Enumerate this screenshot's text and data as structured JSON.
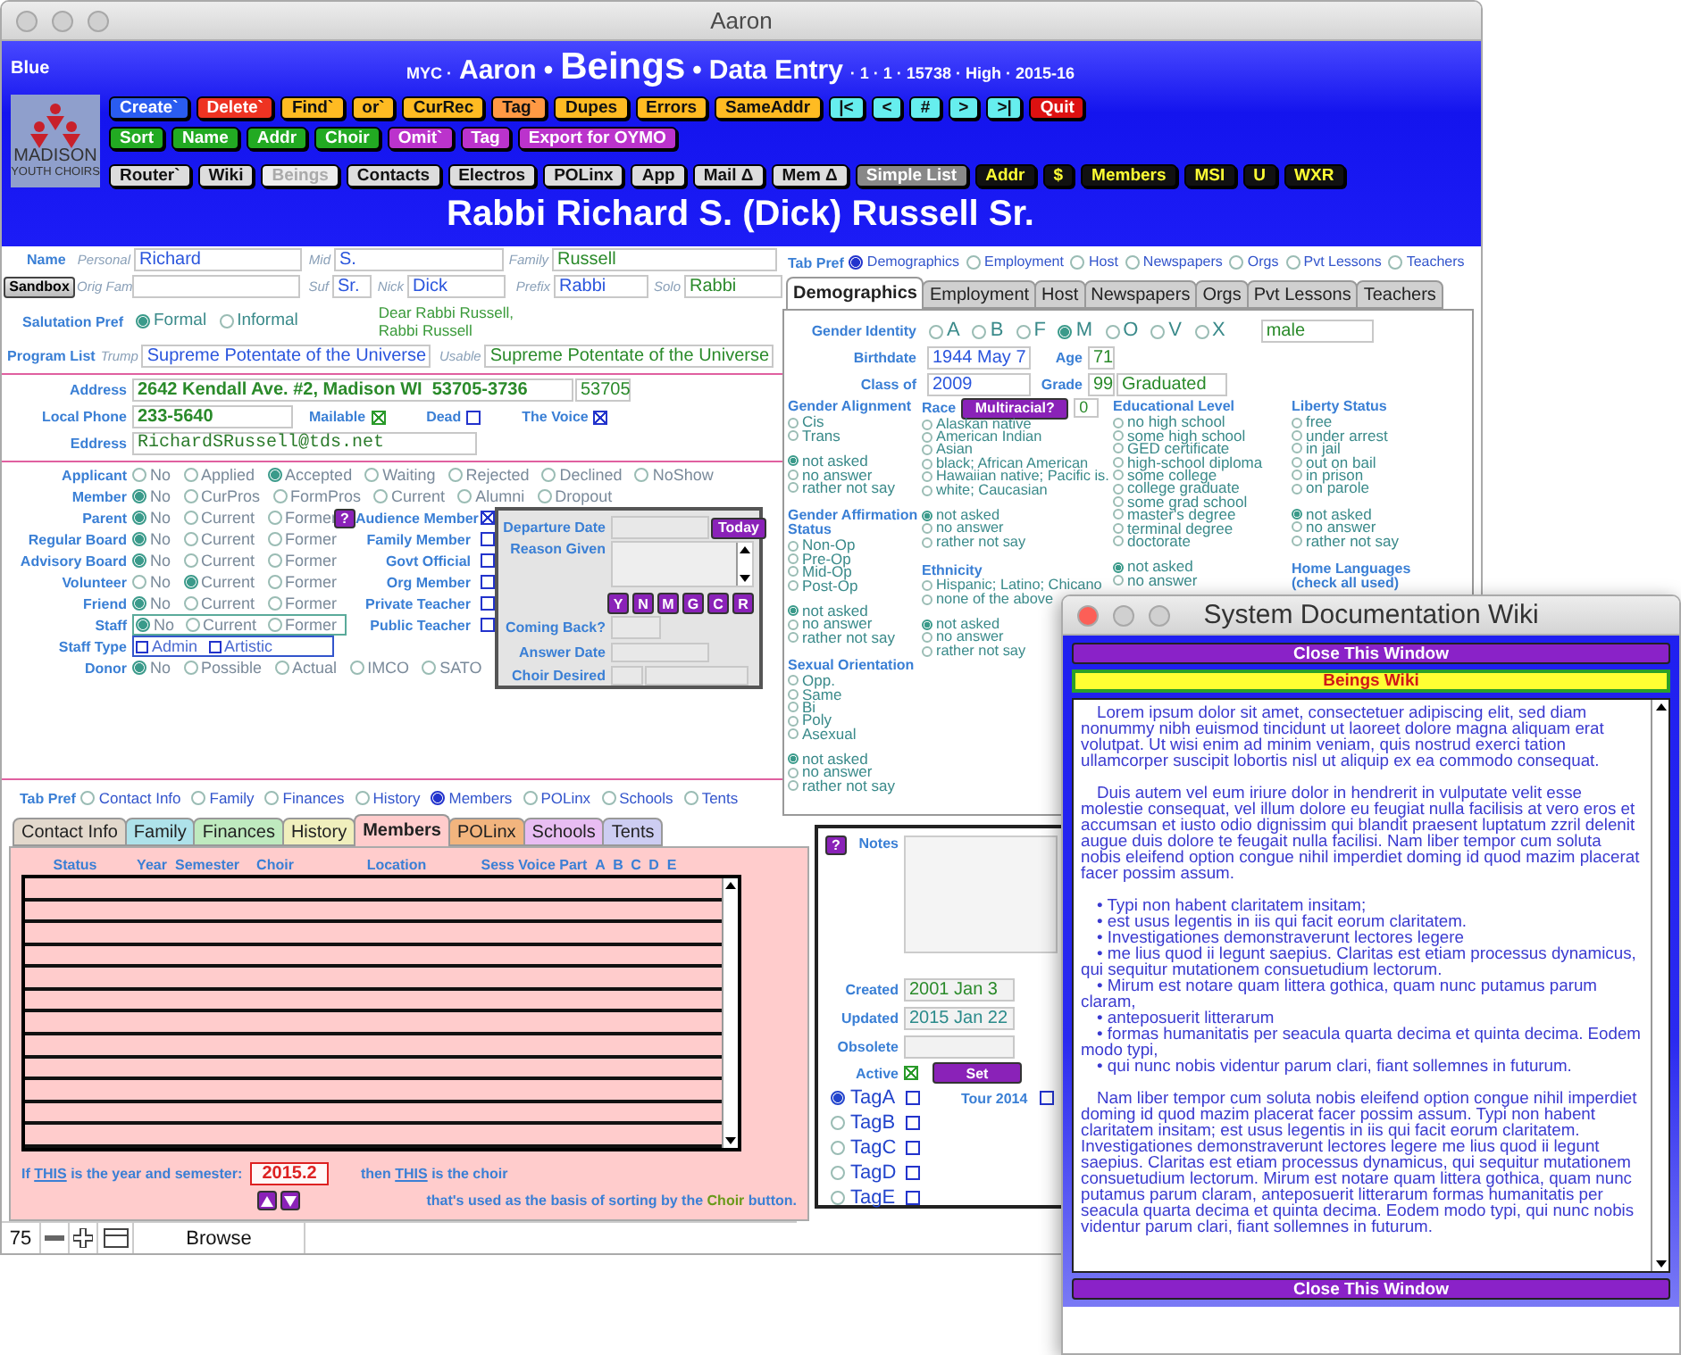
{
  "window": {
    "title": "Aaron"
  },
  "header": {
    "label": "Blue",
    "title": [
      {
        "text": "MYC ·",
        "kind": "small"
      },
      {
        "text": "Aaron",
        "kind": "medium"
      },
      {
        "text": "•",
        "kind": "medium"
      },
      {
        "text": "Beings",
        "kind": "large"
      },
      {
        "text": "•",
        "kind": "medium"
      },
      {
        "text": "Data Entry",
        "kind": "medium"
      },
      {
        "text": "· 1 · 1 · 15738 · High · 2015-16",
        "kind": "small"
      }
    ],
    "logo": [
      "MADISON",
      "YOUTH CHOIRS"
    ],
    "toolbar": [
      [
        {
          "label": "Create`",
          "color": "#2a5cf0"
        },
        {
          "label": "Delete`",
          "color": "#ee3322"
        },
        {
          "label": "Find`",
          "color": "#ffbb22"
        },
        {
          "label": "or`",
          "color": "#ffbb22"
        },
        {
          "label": "CurRec",
          "color": "#ffbb22"
        },
        {
          "label": "Tag`",
          "color": "#ff9944"
        },
        {
          "label": "Dupes",
          "color": "#ffbb22"
        },
        {
          "label": "Errors",
          "color": "#ffbb22"
        },
        {
          "label": "SameAddr",
          "color": "#ffbb22"
        },
        {
          "label": "|<",
          "color": "#66eeee"
        },
        {
          "label": "<",
          "color": "#66eeee"
        },
        {
          "label": "#",
          "color": "#66eeee"
        },
        {
          "label": ">",
          "color": "#66eeee"
        },
        {
          "label": ">|",
          "color": "#66eeee"
        },
        {
          "label": "Quit",
          "color": "#dd1111"
        }
      ],
      [
        {
          "label": "Sort",
          "color": "#22aa22"
        },
        {
          "label": "Name",
          "color": "#22aa22"
        },
        {
          "label": "Addr",
          "color": "#22aa22"
        },
        {
          "label": "Choir",
          "color": "#22aa22"
        },
        {
          "label": "Omit`",
          "color": "#bb33cc"
        },
        {
          "label": "Tag",
          "color": "#bb33cc"
        },
        {
          "label": "Export for OYMO",
          "color": "#bb33cc"
        }
      ],
      [
        {
          "label": "Router`",
          "color": "#dddddd",
          "disabled": false
        },
        {
          "label": "Wiki",
          "color": "#dddddd",
          "disabled": false
        },
        {
          "label": "Beings",
          "color": "#eeeeee",
          "disabled": true
        },
        {
          "label": "Contacts",
          "color": "#dddddd",
          "disabled": false
        },
        {
          "label": "Electros",
          "color": "#dddddd",
          "disabled": false
        },
        {
          "label": "POLinx",
          "color": "#dddddd",
          "disabled": false
        },
        {
          "label": "App",
          "color": "#dddddd",
          "disabled": false
        },
        {
          "label": "Mail Δ",
          "color": "#dddddd",
          "disabled": false
        },
        {
          "label": "Mem Δ",
          "color": "#dddddd",
          "disabled": false
        },
        {
          "label": "Simple List",
          "color": "#888888",
          "disabled": false
        },
        {
          "label": "Addr",
          "color": "#111111",
          "disabled": false
        },
        {
          "label": "$",
          "color": "#111111",
          "disabled": false
        },
        {
          "label": "Members",
          "color": "#111111",
          "disabled": false
        },
        {
          "label": "MSI",
          "color": "#111111",
          "disabled": false
        },
        {
          "label": "U",
          "color": "#111111",
          "disabled": false
        },
        {
          "label": "WXR",
          "color": "#111111",
          "disabled": false
        }
      ]
    ],
    "record_name": "Rabbi Richard S. (Dick) Russell Sr."
  },
  "identity": {
    "name_label": "Name",
    "sandbox": "Sandbox",
    "row1": [
      {
        "hint": "Personal",
        "value": "Richard",
        "kind": "entry"
      },
      {
        "hint": "Mid",
        "value": "S.",
        "kind": "entry"
      },
      {
        "hint": "Family",
        "value": "Russell",
        "kind": "calc"
      }
    ],
    "row2": [
      {
        "hint": "Orig Fam"
      },
      {
        "hint": "Suf",
        "value": "Sr.",
        "kind": "entry"
      },
      {
        "hint": "Nick",
        "value": "Dick",
        "kind": "entry"
      },
      {
        "hint": "Prefix",
        "value": "Rabbi",
        "kind": "entry"
      },
      {
        "hint": "Solo",
        "value": "Rabbi",
        "kind": "calc"
      }
    ],
    "salutation": {
      "label": "Salutation Pref",
      "options": [
        {
          "label": "Formal",
          "selected": true
        },
        {
          "label": "Informal",
          "selected": false
        }
      ],
      "greeting": [
        "Dear Rabbi Russell,",
        "Rabbi Russell"
      ]
    },
    "program": {
      "label": "Program List",
      "fields": [
        {
          "hint": "Trump",
          "value": "Supreme Potentate of the Universe",
          "kind": "entry"
        },
        {
          "hint": "Usable",
          "value": "Supreme Potentate of the Universe",
          "kind": "calc"
        }
      ]
    }
  },
  "contact": {
    "address": {
      "label": "Address",
      "value": "2642 Kendall Ave. #2, Madison WI  53705-3736",
      "zip": "53705"
    },
    "phone": {
      "label": "Local Phone",
      "value": "233-5640"
    },
    "flags": [
      {
        "label": "Mailable",
        "checked": true
      },
      {
        "label": "Dead",
        "checked": false
      },
      {
        "label": "The Voice",
        "checked": true
      }
    ],
    "eddress": {
      "label": "Eddress",
      "value": "RichardSRussell@tds.net"
    }
  },
  "status": {
    "wide": [
      {
        "label": "Applicant",
        "options": [
          {
            "label": "No",
            "selected": false
          },
          {
            "label": "Applied",
            "selected": false
          },
          {
            "label": "Accepted",
            "selected": true
          },
          {
            "label": "Waiting",
            "selected": false
          },
          {
            "label": "Rejected",
            "selected": false
          },
          {
            "label": "Declined",
            "selected": false
          },
          {
            "label": "NoShow",
            "selected": false
          }
        ]
      },
      {
        "label": "Member",
        "options": [
          {
            "label": "No",
            "selected": true
          },
          {
            "label": "CurPros",
            "selected": false
          },
          {
            "label": "FormPros",
            "selected": false
          },
          {
            "label": "Current",
            "selected": false
          },
          {
            "label": "Alumni",
            "selected": false
          },
          {
            "label": "Dropout",
            "selected": false
          }
        ]
      }
    ],
    "roles": [
      {
        "label": "Parent",
        "kind": "radio",
        "options": [
          {
            "label": "No",
            "selected": true
          },
          {
            "label": "Current",
            "selected": false
          },
          {
            "label": "Former",
            "selected": false
          }
        ]
      },
      {
        "label": "Regular Board",
        "kind": "radio",
        "options": [
          {
            "label": "No",
            "selected": true
          },
          {
            "label": "Current",
            "selected": false
          },
          {
            "label": "Former",
            "selected": false
          }
        ]
      },
      {
        "label": "Advisory Board",
        "kind": "radio",
        "options": [
          {
            "label": "No",
            "selected": true
          },
          {
            "label": "Current",
            "selected": false
          },
          {
            "label": "Former",
            "selected": false
          }
        ]
      },
      {
        "label": "Volunteer",
        "kind": "radio",
        "options": [
          {
            "label": "No",
            "selected": false
          },
          {
            "label": "Current",
            "selected": true
          },
          {
            "label": "Former",
            "selected": false
          }
        ]
      },
      {
        "label": "Friend",
        "kind": "radio",
        "options": [
          {
            "label": "No",
            "selected": true
          },
          {
            "label": "Current",
            "selected": false
          },
          {
            "label": "Former",
            "selected": false
          }
        ]
      },
      {
        "label": "Staff",
        "kind": "framed",
        "options": [
          {
            "label": "No",
            "selected": true
          },
          {
            "label": "Current",
            "selected": false
          },
          {
            "label": "Former",
            "selected": false
          }
        ]
      },
      {
        "label": "Staff Type",
        "kind": "checks",
        "options": [
          {
            "label": "Admin",
            "checked": false
          },
          {
            "label": "Artistic",
            "checked": false
          }
        ]
      },
      {
        "label": "Donor",
        "kind": "radio",
        "options": [
          {
            "label": "No",
            "selected": true
          },
          {
            "label": "Possible",
            "selected": false
          },
          {
            "label": "Actual",
            "selected": false
          },
          {
            "label": "IMCO",
            "selected": false
          },
          {
            "label": "SATO",
            "selected": false
          }
        ]
      }
    ],
    "help": "?",
    "checks": [
      {
        "label": "Audience Member",
        "checked": true
      },
      {
        "label": "Family Member",
        "checked": false
      },
      {
        "label": "Govt Official",
        "checked": false
      },
      {
        "label": "Org Member",
        "checked": false
      },
      {
        "label": "Private Teacher",
        "checked": false
      },
      {
        "label": "Public Teacher",
        "checked": false
      }
    ],
    "departure": {
      "date_label": "Departure Date",
      "today": "Today",
      "reason_label": "Reason Given",
      "coming_back_label": "Coming Back?",
      "answers": [
        "Y",
        "N",
        "M",
        "G",
        "C",
        "R"
      ],
      "answer_date_label": "Answer Date",
      "choir_label": "Choir Desired"
    }
  },
  "demographics": {
    "tab_pref": {
      "label": "Tab Pref",
      "options": [
        {
          "label": "Demographics",
          "selected": true
        },
        {
          "label": "Employment",
          "selected": false
        },
        {
          "label": "Host",
          "selected": false
        },
        {
          "label": "Newspapers",
          "selected": false
        },
        {
          "label": "Orgs",
          "selected": false
        },
        {
          "label": "Pvt Lessons",
          "selected": false
        },
        {
          "label": "Teachers",
          "selected": false
        }
      ]
    },
    "tabs": [
      {
        "label": "Demographics",
        "selected": true
      },
      {
        "label": "Employment",
        "selected": false
      },
      {
        "label": "Host",
        "selected": false
      },
      {
        "label": "Newspapers",
        "selected": false
      },
      {
        "label": "Orgs",
        "selected": false
      },
      {
        "label": "Pvt Lessons",
        "selected": false
      },
      {
        "label": "Teachers",
        "selected": false
      }
    ],
    "gender_identity": {
      "label": "Gender Identity",
      "options": [
        {
          "label": "A",
          "selected": false
        },
        {
          "label": "B",
          "selected": false
        },
        {
          "label": "F",
          "selected": false
        },
        {
          "label": "M",
          "selected": true
        },
        {
          "label": "O",
          "selected": false
        },
        {
          "label": "V",
          "selected": false
        },
        {
          "label": "X",
          "selected": false
        }
      ],
      "value": "male"
    },
    "birthdate": {
      "label": "Birthdate",
      "value": "1944 May 7"
    },
    "age": {
      "label": "Age",
      "value": "71"
    },
    "class_of": {
      "label": "Class of",
      "value": "2009"
    },
    "grade": {
      "label": "Grade",
      "value": "99",
      "status": "Graduated"
    },
    "columns": [
      [
        {
          "title": "Gender Alignment",
          "options": [
            {
              "label": "Cis",
              "selected": false
            },
            {
              "label": "Trans",
              "selected": false
            }
          ],
          "answers": [
            {
              "label": "not asked",
              "selected": true
            },
            {
              "label": "no answer",
              "selected": false
            },
            {
              "label": "rather not say",
              "selected": false
            }
          ]
        },
        {
          "title": "Gender Affirmation Status",
          "options": [
            {
              "label": "Non-Op",
              "selected": false
            },
            {
              "label": "Pre-Op",
              "selected": false
            },
            {
              "label": "Mid-Op",
              "selected": false
            },
            {
              "label": "Post-Op",
              "selected": false
            }
          ],
          "answers": [
            {
              "label": "not asked",
              "selected": true
            },
            {
              "label": "no answer",
              "selected": false
            },
            {
              "label": "rather not say",
              "selected": false
            }
          ]
        },
        {
          "title": "Sexual Orientation",
          "options": [
            {
              "label": "Opp.",
              "selected": false
            },
            {
              "label": "Same",
              "selected": false
            },
            {
              "label": "Bi",
              "selected": false
            },
            {
              "label": "Poly",
              "selected": false
            },
            {
              "label": "Asexual",
              "selected": false
            }
          ],
          "answers": [
            {
              "label": "not asked",
              "selected": true
            },
            {
              "label": "no answer",
              "selected": false
            },
            {
              "label": "rather not say",
              "selected": false
            }
          ]
        }
      ],
      [
        {
          "title": "Race",
          "button": "Multiracial?",
          "count": "0",
          "options": [
            {
              "label": "Alaskan native",
              "selected": false
            },
            {
              "label": "American Indian",
              "selected": false
            },
            {
              "label": "Asian",
              "selected": false
            },
            {
              "label": "black; African American",
              "selected": false
            },
            {
              "label": "Hawaiian native; Pacific is.",
              "selected": false
            },
            {
              "label": "white; Caucasian",
              "selected": false
            }
          ],
          "answers": [
            {
              "label": "not asked",
              "selected": true
            },
            {
              "label": "no answer",
              "selected": false
            },
            {
              "label": "rather not say",
              "selected": false
            }
          ]
        },
        {
          "title": "Ethnicity",
          "options": [
            {
              "label": "Hispanic; Latino; Chicano",
              "selected": false
            },
            {
              "label": "none of the above",
              "selected": false
            }
          ],
          "answers": [
            {
              "label": "not asked",
              "selected": true
            },
            {
              "label": "no answer",
              "selected": false
            },
            {
              "label": "rather not say",
              "selected": false
            }
          ]
        }
      ],
      [
        {
          "title": "Educational Level",
          "options": [
            {
              "label": "no high school",
              "selected": false
            },
            {
              "label": "some high school",
              "selected": false
            },
            {
              "label": "GED certificate",
              "selected": false
            },
            {
              "label": "high-school diploma",
              "selected": false
            },
            {
              "label": "some college",
              "selected": false
            },
            {
              "label": "college graduate",
              "selected": false
            },
            {
              "label": "some grad school",
              "selected": false
            },
            {
              "label": "master's degree",
              "selected": false
            },
            {
              "label": "terminal degree",
              "selected": false
            },
            {
              "label": "doctorate",
              "selected": false
            }
          ],
          "answers": [
            {
              "label": "not asked",
              "selected": true
            },
            {
              "label": "no answer",
              "selected": false
            }
          ]
        }
      ],
      [
        {
          "title": "Liberty Status",
          "options": [
            {
              "label": "free",
              "selected": false
            },
            {
              "label": "under arrest",
              "selected": false
            },
            {
              "label": "in jail",
              "selected": false
            },
            {
              "label": "out on bail",
              "selected": false
            },
            {
              "label": "in prison",
              "selected": false
            },
            {
              "label": "on parole",
              "selected": false
            }
          ],
          "answers": [
            {
              "label": "not asked",
              "selected": true
            },
            {
              "label": "no answer",
              "selected": false
            },
            {
              "label": "rather not say",
              "selected": false
            }
          ]
        },
        {
          "title": "Home Languages (check all used)"
        }
      ]
    ]
  },
  "members": {
    "tab_pref": {
      "label": "Tab Pref",
      "options": [
        {
          "label": "Contact Info",
          "selected": false
        },
        {
          "label": "Family",
          "selected": false
        },
        {
          "label": "Finances",
          "selected": false
        },
        {
          "label": "History",
          "selected": false
        },
        {
          "label": "Members",
          "selected": true
        },
        {
          "label": "POLinx",
          "selected": false
        },
        {
          "label": "Schools",
          "selected": false
        },
        {
          "label": "Tents",
          "selected": false
        }
      ]
    },
    "tabs": [
      {
        "label": "Contact Info",
        "selected": false,
        "color": "#e2d8cc"
      },
      {
        "label": "Family",
        "selected": false,
        "color": "#aee2ea"
      },
      {
        "label": "Finances",
        "selected": false,
        "color": "#bfeabf"
      },
      {
        "label": "History",
        "selected": false,
        "color": "#f0efbd"
      },
      {
        "label": "Members",
        "selected": true,
        "color": "#ffcccc"
      },
      {
        "label": "POLinx",
        "selected": false,
        "color": "#f2b57e"
      },
      {
        "label": "Schools",
        "selected": false,
        "color": "#e8bdf2"
      },
      {
        "label": "Tents",
        "selected": false,
        "color": "#cdcdf2"
      }
    ],
    "columns": [
      "Status",
      "Year",
      "Semester",
      "Choir",
      "Location",
      "Sess Voice Part",
      "A",
      "B",
      "C",
      "D",
      "E"
    ],
    "year_text": [
      {
        "text": "If ",
        "kind": "plain"
      },
      {
        "text": "THIS",
        "kind": "link"
      },
      {
        "text": " is the year and semester:",
        "kind": "plain"
      }
    ],
    "semester": "2015.2",
    "choir_text": [
      {
        "text": "then ",
        "kind": "plain"
      },
      {
        "text": "THIS",
        "kind": "link"
      },
      {
        "text": " is the choir",
        "kind": "plain"
      }
    ],
    "sort_text": [
      {
        "text": "that's used as the basis of sorting by the ",
        "kind": "plain"
      },
      {
        "text": "Choir",
        "kind": "accent"
      },
      {
        "text": " button.",
        "kind": "plain"
      }
    ]
  },
  "notes": {
    "help": "?",
    "label": "Notes",
    "dates": [
      {
        "label": "Created",
        "value": "2001 Jan 3"
      },
      {
        "label": "Updated",
        "value": "2015 Jan 22"
      },
      {
        "label": "Obsolete"
      }
    ],
    "active": {
      "label": "Active",
      "checked": true,
      "button": "Set"
    },
    "tags": [
      {
        "label": "TagA",
        "selected": true,
        "checked": false
      },
      {
        "label": "TagB",
        "selected": false,
        "checked": false
      },
      {
        "label": "TagC",
        "selected": false,
        "checked": false
      },
      {
        "label": "TagD",
        "selected": false,
        "checked": false
      },
      {
        "label": "TagE",
        "selected": false,
        "checked": false
      }
    ],
    "tour": {
      "label": "Tour 2014",
      "checked": false
    }
  },
  "status_bar": {
    "zoom": "75",
    "mode": "Browse"
  },
  "wiki": {
    "title": "System Documentation Wiki",
    "close": [
      "Close This Window",
      "Close This Window"
    ],
    "heading": "Beings Wiki",
    "blocks": [
      {
        "kind": "para",
        "text": "Lorem ipsum dolor sit amet, consectetuer adipiscing elit, sed diam nonummy nibh euismod tincidunt ut laoreet dolore magna aliquam erat volutpat. Ut wisi enim ad minim veniam, quis nostrud exerci tation ullamcorper suscipit lobortis nisl ut aliquip ex ea commodo consequat."
      },
      {
        "kind": "para",
        "text": "Duis autem vel eum iriure dolor in hendrerit in vulputate velit esse molestie consequat, vel illum dolore eu feugiat nulla facilisis at vero eros et accumsan et iusto odio dignissim qui blandit praesent luptatum zzril delenit augue duis dolore te feugait nulla facilisi. Nam liber tempor cum soluta nobis eleifend option congue nihil imperdiet doming id quod mazim placerat facer possim assum."
      },
      {
        "kind": "bullet",
        "text": "• Typi non habent claritatem insitam;"
      },
      {
        "kind": "bullet",
        "text": "• est usus legentis in iis qui facit eorum claritatem."
      },
      {
        "kind": "bullet",
        "text": "• Investigationes demonstraverunt lectores legere"
      },
      {
        "kind": "bullet",
        "text": "• me lius quod ii legunt saepius. Claritas est etiam processus dynamicus, qui sequitur mutationem consuetudium lectorum."
      },
      {
        "kind": "bullet",
        "text": "• Mirum est notare quam littera gothica, quam nunc putamus parum claram,"
      },
      {
        "kind": "bullet",
        "text": "• anteposuerit litterarum"
      },
      {
        "kind": "bullet",
        "text": "• formas humanitatis per seacula quarta decima et quinta decima. Eodem modo typi,"
      },
      {
        "kind": "bullet",
        "text": "• qui nunc nobis videntur parum clari, fiant sollemnes in futurum."
      },
      {
        "kind": "para",
        "text": "Nam liber tempor cum soluta nobis eleifend option congue nihil imperdiet doming id quod mazim placerat facer possim assum. Typi non habent claritatem insitam; est usus legentis in iis qui facit eorum claritatem. Investigationes demonstraverunt lectores legere me lius quod ii legunt saepius. Claritas est etiam processus dynamicus, qui sequitur mutationem consuetudium lectorum. Mirum est notare quam littera gothica, quam nunc putamus parum claram, anteposuerit litterarum formas humanitatis per seacula quarta decima et quinta decima. Eodem modo typi, qui nunc nobis videntur parum clari, fiant sollemnes in futurum."
      }
    ]
  }
}
